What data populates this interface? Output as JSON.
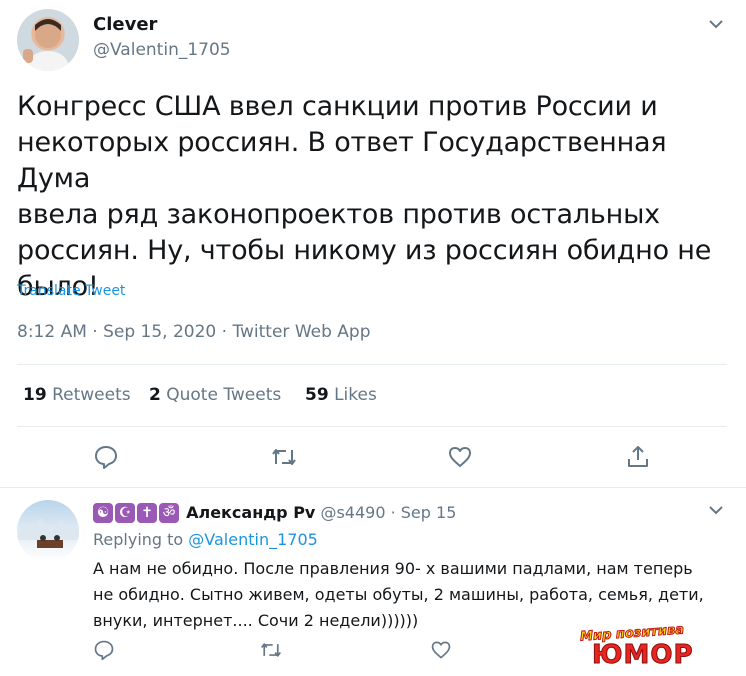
{
  "tweet": {
    "author_name": "Clever",
    "author_handle": "@Valentin_1705",
    "text": "Конгресс США ввел санкции против России и некоторых россиян. В ответ Государственная Дума ввела ряд законопроектов против остальных россиян. Ну, чтобы никому из россиян обидно не было!",
    "text_lines": [
      "Конгресс США ввел санкции против России и",
      "некоторых россиян. В ответ Государственная Дума",
      "ввела ряд законопроектов против остальных",
      "россиян. Ну, чтобы никому из россиян обидно не",
      "было!"
    ],
    "translate_label": "Translate Tweet",
    "meta": "8:12 AM · Sep 15, 2020 · Twitter Web App",
    "stats": {
      "retweets_count": "19",
      "retweets_label": "Retweets",
      "quote_count": "2",
      "quote_label": "Quote Tweets",
      "likes_count": "59",
      "likes_label": "Likes"
    }
  },
  "reply": {
    "badges": [
      "☯",
      "☪",
      "✝",
      "ॐ"
    ],
    "author_name": "Александр Pv",
    "author_handle": "@s4490",
    "date": "· Sep 15",
    "replying_prefix": "Replying to",
    "replying_to": "@Valentin_1705",
    "text_lines": [
      "А нам не обидно. После правления 90- х вашими падлами, нам теперь",
      "не обидно. Сытно живем, одеты обуты, 2 машины, работа, семья, дети,",
      "внуки, интернет.... Сочи 2 недели))))))"
    ]
  },
  "watermark": {
    "line1": "Мир позитива",
    "line2": "ЮМОР"
  },
  "icons": {
    "chevron": "chevron-down-icon",
    "reply": "reply-icon",
    "retweet": "retweet-icon",
    "like": "like-icon",
    "share": "share-icon"
  },
  "colors": {
    "accent": "#1b95e0",
    "secondary_text": "#657786",
    "divider": "#e6ecf0",
    "badge_purple": "#9b59b6"
  }
}
